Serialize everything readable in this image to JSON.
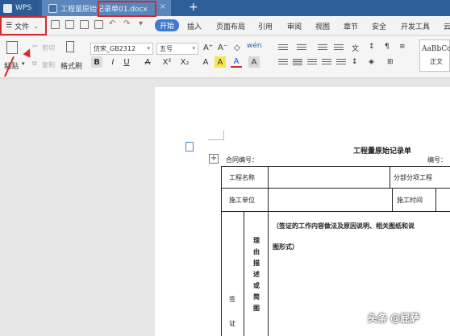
{
  "tabbar": {
    "app_tab": "WPS",
    "doc_tab": "工程量原始记录单01.docx",
    "close_glyph": "×",
    "add_glyph": "+"
  },
  "menubar": {
    "file_menu": "文件",
    "chevron": "⌄",
    "undo": "↶",
    "redo": "↷",
    "start": "开始",
    "items": [
      "插入",
      "页面布局",
      "引用",
      "审阅",
      "视图",
      "章节",
      "安全",
      "开发工具",
      "云"
    ]
  },
  "ribbon": {
    "paste": "粘贴",
    "cut": "剪切",
    "copy": "复制",
    "format_painter": "格式刷",
    "font_name": "仿宋_GB2312",
    "font_size": "五号",
    "grow_font": "A⁺",
    "shrink_font": "A⁻",
    "clear_format": "◇",
    "pinyin": "wén",
    "bold": "B",
    "italic": "I",
    "underline": "U",
    "strikethrough": "A",
    "superscript": "X²",
    "subscript": "X₂",
    "font_color": "A",
    "highlight": "A",
    "char_shade": "A",
    "style_preview": "AaBbCc",
    "style_name": "正文"
  },
  "document": {
    "title": "工程量原始记录单",
    "contract_no": "合同编号：",
    "number": "编号：",
    "project_name": "工程名称",
    "sub_project": "分部分项工程",
    "construction_unit": "施工单位",
    "construction_time": "施工时间",
    "instruction_line1": "（签证的工作内容做法及原因说明、相关图纸和说",
    "instruction_line2": "图形式）",
    "vertical_text": "理由描述或简图",
    "visa_label_1": "签",
    "visa_label_2": "证"
  },
  "watermark": "头条 @屁萨",
  "colors": {
    "tabbar": "#2f5f99",
    "start_tab": "#3f7ad1",
    "highlight_box": "#d62a2a"
  }
}
